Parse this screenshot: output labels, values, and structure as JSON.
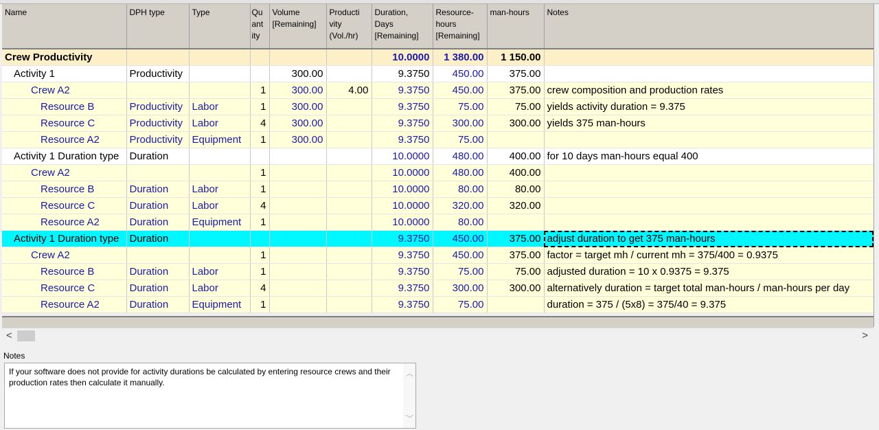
{
  "columns": [
    "Name",
    "DPH type",
    "Type",
    "Quantity",
    "Volume [Remaining]",
    "Productivity (Vol./hr)",
    "Duration, Days [Remaining]",
    "Resource-hours [Remaining]",
    "man-hours",
    "Notes"
  ],
  "header_labels": {
    "name": "Name",
    "dph": "DPH type",
    "type": "Type",
    "qty": [
      "Qu",
      "ant",
      "ity"
    ],
    "volume": [
      "Volume",
      "[Remaining]"
    ],
    "prod": [
      "Producti",
      "vity",
      "(Vol./hr)"
    ],
    "duration": [
      "Duration,",
      "Days",
      "[Remaining]"
    ],
    "reshours": [
      "Resource-",
      "hours",
      "[Remaining]"
    ],
    "manhours": "man-hours",
    "notes": "Notes"
  },
  "rows": [
    {
      "name": "Crew Productivity",
      "dph": "",
      "type": "",
      "qty": "",
      "volume": "",
      "prod": "",
      "duration": "10.0000",
      "reshours": "1 380.00",
      "manhours": "1 150.00",
      "notes": ""
    },
    {
      "name": "Activity 1",
      "dph": "Productivity",
      "type": "",
      "qty": "",
      "volume": "300.00",
      "prod": "",
      "duration": "9.3750",
      "reshours": "450.00",
      "manhours": "375.00",
      "notes": ""
    },
    {
      "name": "Crew A2",
      "dph": "",
      "type": "",
      "qty": "1",
      "volume": "300.00",
      "prod": "4.00",
      "duration": "9.3750",
      "reshours": "450.00",
      "manhours": "375.00",
      "notes": "crew composition and production rates"
    },
    {
      "name": "Resource B",
      "dph": "Productivity",
      "type": "Labor",
      "qty": "1",
      "volume": "300.00",
      "prod": "",
      "duration": "9.3750",
      "reshours": "75.00",
      "manhours": "75.00",
      "notes": "yields activity duration = 9.375"
    },
    {
      "name": "Resource C",
      "dph": "Productivity",
      "type": "Labor",
      "qty": "4",
      "volume": "300.00",
      "prod": "",
      "duration": "9.3750",
      "reshours": "300.00",
      "manhours": "300.00",
      "notes": "yields 375 man-hours"
    },
    {
      "name": "Resource A2",
      "dph": "Productivity",
      "type": "Equipment",
      "qty": "1",
      "volume": "300.00",
      "prod": "",
      "duration": "9.3750",
      "reshours": "75.00",
      "manhours": "",
      "notes": ""
    },
    {
      "name": "Activity 1 Duration type",
      "dph": "Duration",
      "type": "",
      "qty": "",
      "volume": "",
      "prod": "",
      "duration": "10.0000",
      "reshours": "480.00",
      "manhours": "400.00",
      "notes": "for 10 days man-hours equal 400"
    },
    {
      "name": "Crew A2",
      "dph": "",
      "type": "",
      "qty": "1",
      "volume": "",
      "prod": "",
      "duration": "10.0000",
      "reshours": "480.00",
      "manhours": "400.00",
      "notes": ""
    },
    {
      "name": "Resource B",
      "dph": "Duration",
      "type": "Labor",
      "qty": "1",
      "volume": "",
      "prod": "",
      "duration": "10.0000",
      "reshours": "80.00",
      "manhours": "80.00",
      "notes": ""
    },
    {
      "name": "Resource C",
      "dph": "Duration",
      "type": "Labor",
      "qty": "4",
      "volume": "",
      "prod": "",
      "duration": "10.0000",
      "reshours": "320.00",
      "manhours": "320.00",
      "notes": ""
    },
    {
      "name": "Resource A2",
      "dph": "Duration",
      "type": "Equipment",
      "qty": "1",
      "volume": "",
      "prod": "",
      "duration": "10.0000",
      "reshours": "80.00",
      "manhours": "",
      "notes": ""
    },
    {
      "name": "Activity 1 Duration type",
      "dph": "Duration",
      "type": "",
      "qty": "",
      "volume": "",
      "prod": "",
      "duration": "9.3750",
      "reshours": "450.00",
      "manhours": "375.00",
      "notes": "adjust duration to get 375 man-hours"
    },
    {
      "name": "Crew A2",
      "dph": "",
      "type": "",
      "qty": "1",
      "volume": "",
      "prod": "",
      "duration": "9.3750",
      "reshours": "450.00",
      "manhours": "375.00",
      "notes": "factor = target mh / current mh =  375/400 = 0.9375"
    },
    {
      "name": "Resource B",
      "dph": "Duration",
      "type": "Labor",
      "qty": "1",
      "volume": "",
      "prod": "",
      "duration": "9.3750",
      "reshours": "75.00",
      "manhours": "75.00",
      "notes": "adjusted duration = 10 x 0.9375 = 9.375"
    },
    {
      "name": "Resource C",
      "dph": "Duration",
      "type": "Labor",
      "qty": "4",
      "volume": "",
      "prod": "",
      "duration": "9.3750",
      "reshours": "300.00",
      "manhours": "300.00",
      "notes": "alternatively duration = target total man-hours / man-hours per day"
    },
    {
      "name": "Resource A2",
      "dph": "Duration",
      "type": "Equipment",
      "qty": "1",
      "volume": "",
      "prod": "",
      "duration": "9.3750",
      "reshours": "75.00",
      "manhours": "",
      "notes": "duration = 375 / (5x8) = 375/40 = 9.375"
    }
  ],
  "scroll": {
    "left": "<",
    "right": ">"
  },
  "notes_panel": {
    "title": "Notes",
    "text": "If your software does not provide for activity durations be calculated by entering resource crews and their production rates then calculate it manually."
  },
  "colors": {
    "section": "#fdefc8",
    "crew_rows": "#ffffd9",
    "selected": "#00f7ff",
    "link_text": "#1a1aa8"
  }
}
